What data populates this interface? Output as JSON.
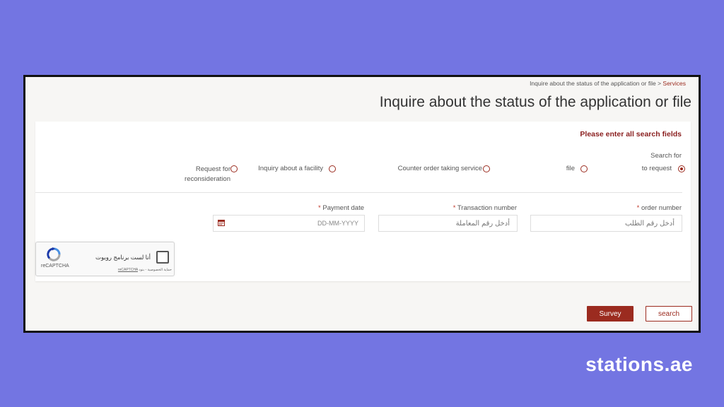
{
  "breadcrumb": {
    "current": "Inquire about the status of the application or file",
    "separator": ">",
    "parent": "Services"
  },
  "page_title": "Inquire about the status of the application or file",
  "form": {
    "notice": "Please enter all search fields",
    "search_for_label": "Search for",
    "options": [
      {
        "label": "to request",
        "selected": true
      },
      {
        "label": "file",
        "selected": false
      },
      {
        "label": "Counter order taking service",
        "selected": false
      },
      {
        "label": "Inquiry about a facility",
        "selected": false
      },
      {
        "label": "Request for reconsideration",
        "label_line1": "Request for",
        "label_line2": "reconsideration",
        "selected": false
      }
    ],
    "fields": {
      "order_number": {
        "label": "order number",
        "required_mark": "*",
        "placeholder": "أدخل رقم الطلب"
      },
      "transaction_number": {
        "label": "Transaction number",
        "required_mark": "*",
        "placeholder": "أدخل رقم المعاملة"
      },
      "payment_date": {
        "label": "Payment date",
        "required_mark": "*",
        "placeholder": "DD-MM-YYYY",
        "icon": "calendar-icon"
      }
    }
  },
  "recaptcha": {
    "checkbox_label": "أنا لست برنامج روبوت",
    "brand": "reCAPTCHA",
    "terms_prefix": "حماية الخصوصية - بنود",
    "terms_link": "reCAPTCHA"
  },
  "buttons": {
    "survey": "Survey",
    "search": "search"
  },
  "watermark": "stations.ae",
  "colors": {
    "accent": "#9b2b1f",
    "background": "#7375e2",
    "panel": "#f7f6f4"
  }
}
